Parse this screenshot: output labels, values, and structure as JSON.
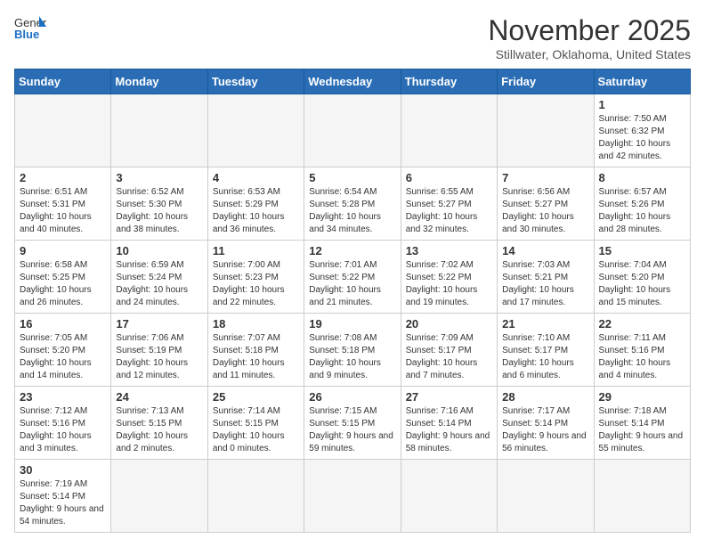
{
  "header": {
    "logo_general": "General",
    "logo_blue": "Blue",
    "title": "November 2025",
    "subtitle": "Stillwater, Oklahoma, United States"
  },
  "days_of_week": [
    "Sunday",
    "Monday",
    "Tuesday",
    "Wednesday",
    "Thursday",
    "Friday",
    "Saturday"
  ],
  "weeks": [
    [
      {
        "day": "",
        "info": ""
      },
      {
        "day": "",
        "info": ""
      },
      {
        "day": "",
        "info": ""
      },
      {
        "day": "",
        "info": ""
      },
      {
        "day": "",
        "info": ""
      },
      {
        "day": "",
        "info": ""
      },
      {
        "day": "1",
        "info": "Sunrise: 7:50 AM\nSunset: 6:32 PM\nDaylight: 10 hours\nand 42 minutes."
      }
    ],
    [
      {
        "day": "2",
        "info": "Sunrise: 6:51 AM\nSunset: 5:31 PM\nDaylight: 10 hours\nand 40 minutes."
      },
      {
        "day": "3",
        "info": "Sunrise: 6:52 AM\nSunset: 5:30 PM\nDaylight: 10 hours\nand 38 minutes."
      },
      {
        "day": "4",
        "info": "Sunrise: 6:53 AM\nSunset: 5:29 PM\nDaylight: 10 hours\nand 36 minutes."
      },
      {
        "day": "5",
        "info": "Sunrise: 6:54 AM\nSunset: 5:28 PM\nDaylight: 10 hours\nand 34 minutes."
      },
      {
        "day": "6",
        "info": "Sunrise: 6:55 AM\nSunset: 5:27 PM\nDaylight: 10 hours\nand 32 minutes."
      },
      {
        "day": "7",
        "info": "Sunrise: 6:56 AM\nSunset: 5:27 PM\nDaylight: 10 hours\nand 30 minutes."
      },
      {
        "day": "8",
        "info": "Sunrise: 6:57 AM\nSunset: 5:26 PM\nDaylight: 10 hours\nand 28 minutes."
      }
    ],
    [
      {
        "day": "9",
        "info": "Sunrise: 6:58 AM\nSunset: 5:25 PM\nDaylight: 10 hours\nand 26 minutes."
      },
      {
        "day": "10",
        "info": "Sunrise: 6:59 AM\nSunset: 5:24 PM\nDaylight: 10 hours\nand 24 minutes."
      },
      {
        "day": "11",
        "info": "Sunrise: 7:00 AM\nSunset: 5:23 PM\nDaylight: 10 hours\nand 22 minutes."
      },
      {
        "day": "12",
        "info": "Sunrise: 7:01 AM\nSunset: 5:22 PM\nDaylight: 10 hours\nand 21 minutes."
      },
      {
        "day": "13",
        "info": "Sunrise: 7:02 AM\nSunset: 5:22 PM\nDaylight: 10 hours\nand 19 minutes."
      },
      {
        "day": "14",
        "info": "Sunrise: 7:03 AM\nSunset: 5:21 PM\nDaylight: 10 hours\nand 17 minutes."
      },
      {
        "day": "15",
        "info": "Sunrise: 7:04 AM\nSunset: 5:20 PM\nDaylight: 10 hours\nand 15 minutes."
      }
    ],
    [
      {
        "day": "16",
        "info": "Sunrise: 7:05 AM\nSunset: 5:20 PM\nDaylight: 10 hours\nand 14 minutes."
      },
      {
        "day": "17",
        "info": "Sunrise: 7:06 AM\nSunset: 5:19 PM\nDaylight: 10 hours\nand 12 minutes."
      },
      {
        "day": "18",
        "info": "Sunrise: 7:07 AM\nSunset: 5:18 PM\nDaylight: 10 hours\nand 11 minutes."
      },
      {
        "day": "19",
        "info": "Sunrise: 7:08 AM\nSunset: 5:18 PM\nDaylight: 10 hours\nand 9 minutes."
      },
      {
        "day": "20",
        "info": "Sunrise: 7:09 AM\nSunset: 5:17 PM\nDaylight: 10 hours\nand 7 minutes."
      },
      {
        "day": "21",
        "info": "Sunrise: 7:10 AM\nSunset: 5:17 PM\nDaylight: 10 hours\nand 6 minutes."
      },
      {
        "day": "22",
        "info": "Sunrise: 7:11 AM\nSunset: 5:16 PM\nDaylight: 10 hours\nand 4 minutes."
      }
    ],
    [
      {
        "day": "23",
        "info": "Sunrise: 7:12 AM\nSunset: 5:16 PM\nDaylight: 10 hours\nand 3 minutes."
      },
      {
        "day": "24",
        "info": "Sunrise: 7:13 AM\nSunset: 5:15 PM\nDaylight: 10 hours\nand 2 minutes."
      },
      {
        "day": "25",
        "info": "Sunrise: 7:14 AM\nSunset: 5:15 PM\nDaylight: 10 hours\nand 0 minutes."
      },
      {
        "day": "26",
        "info": "Sunrise: 7:15 AM\nSunset: 5:15 PM\nDaylight: 9 hours\nand 59 minutes."
      },
      {
        "day": "27",
        "info": "Sunrise: 7:16 AM\nSunset: 5:14 PM\nDaylight: 9 hours\nand 58 minutes."
      },
      {
        "day": "28",
        "info": "Sunrise: 7:17 AM\nSunset: 5:14 PM\nDaylight: 9 hours\nand 56 minutes."
      },
      {
        "day": "29",
        "info": "Sunrise: 7:18 AM\nSunset: 5:14 PM\nDaylight: 9 hours\nand 55 minutes."
      }
    ],
    [
      {
        "day": "30",
        "info": "Sunrise: 7:19 AM\nSunset: 5:14 PM\nDaylight: 9 hours\nand 54 minutes."
      },
      {
        "day": "",
        "info": ""
      },
      {
        "day": "",
        "info": ""
      },
      {
        "day": "",
        "info": ""
      },
      {
        "day": "",
        "info": ""
      },
      {
        "day": "",
        "info": ""
      },
      {
        "day": "",
        "info": ""
      }
    ]
  ]
}
